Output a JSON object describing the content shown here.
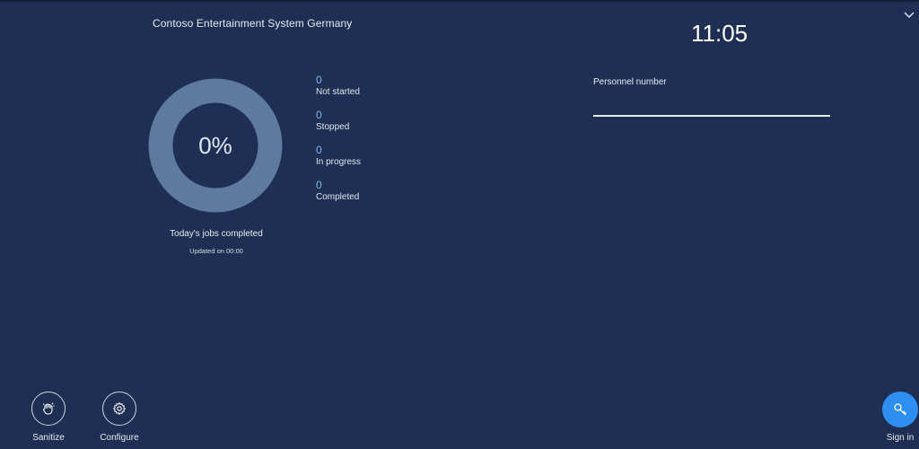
{
  "header": {
    "company_name": "Contoso Entertainment System Germany",
    "time": "11:05",
    "menu_icon": "chevron-down-icon"
  },
  "jobs_summary": {
    "percent_label": "0%",
    "percent_value": 0,
    "caption": "Today's jobs completed",
    "updated": "Updated on 00:00",
    "stats": [
      {
        "count": "0",
        "label": "Not started"
      },
      {
        "count": "0",
        "label": "Stopped"
      },
      {
        "count": "0",
        "label": "In progress"
      },
      {
        "count": "0",
        "label": "Completed"
      }
    ]
  },
  "signin_form": {
    "field_label": "Personnel number",
    "field_value": ""
  },
  "footer": {
    "sanitize_label": "Sanitize",
    "sanitize_icon": "sanitize-hand-icon",
    "configure_label": "Configure",
    "configure_icon": "gear-icon",
    "signin_label": "Sign in",
    "signin_icon": "key-icon"
  },
  "colors": {
    "background": "#1e2f53",
    "donut_ring": "#5e7a9f",
    "accent": "#2f8ff0",
    "stat_count": "#7fb6ee"
  }
}
